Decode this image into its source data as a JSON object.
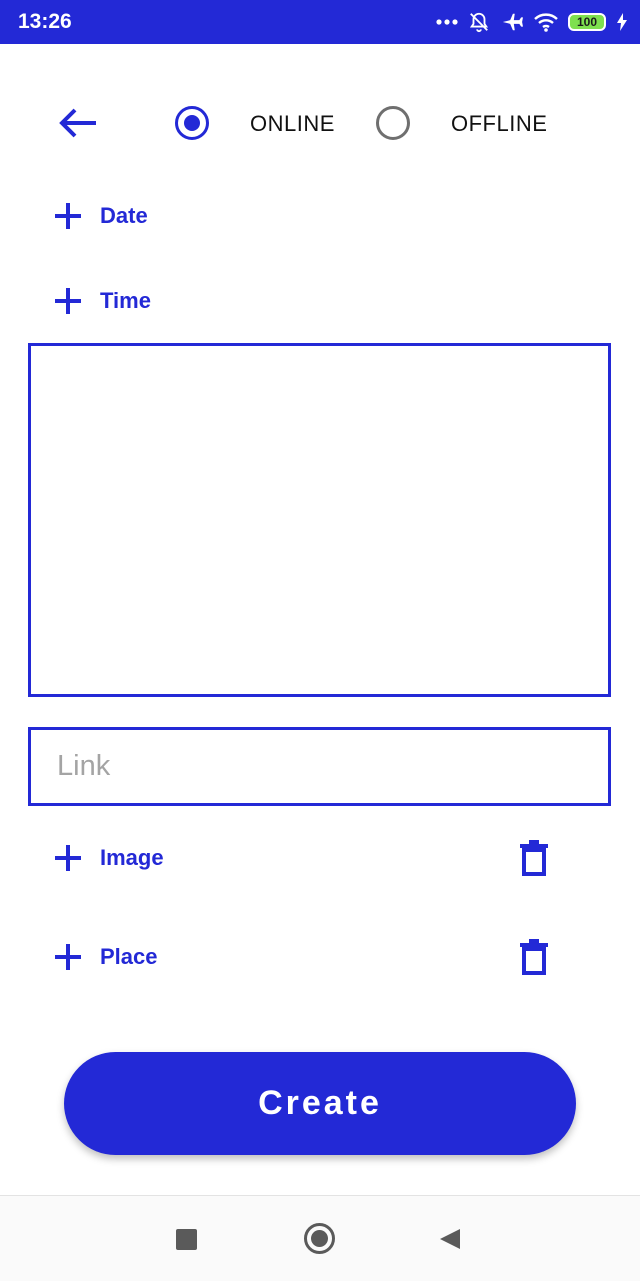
{
  "status_bar": {
    "time": "13:26",
    "battery_level": "100",
    "icons": [
      "more-dots-icon",
      "bell-off-icon",
      "airplane-icon",
      "wifi-icon",
      "battery-icon",
      "charging-icon"
    ]
  },
  "header": {
    "mode_options": [
      {
        "label": "ONLINE",
        "selected": true
      },
      {
        "label": "OFFLINE",
        "selected": false
      }
    ]
  },
  "form": {
    "date_label": "Date",
    "time_label": "Time",
    "description_value": "",
    "link_placeholder": "Link",
    "link_value": "",
    "image_label": "Image",
    "place_label": "Place"
  },
  "actions": {
    "create_label": "Create"
  },
  "colors": {
    "primary": "#2329d6",
    "background": "#ffffff",
    "radio_inactive": "#6f6f6f",
    "placeholder": "#a4a4a4"
  }
}
